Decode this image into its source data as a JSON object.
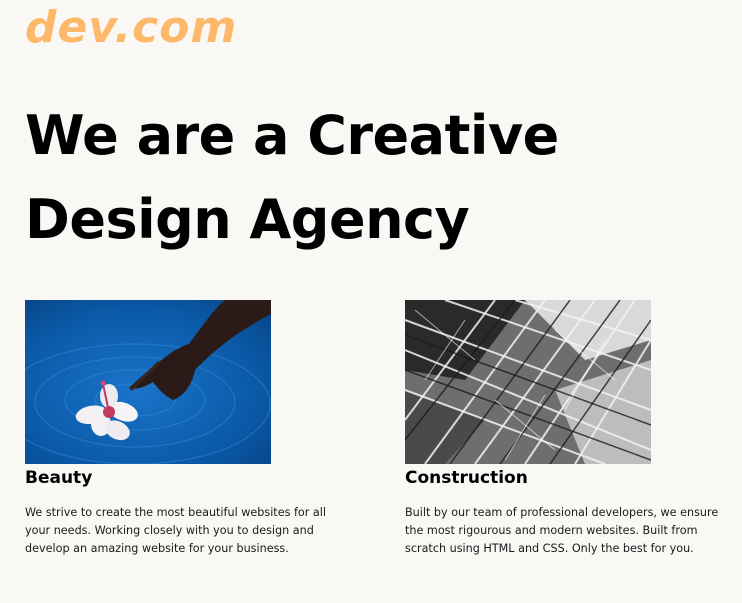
{
  "brand": {
    "logo_text": "dev.com",
    "color": "#fdb86a"
  },
  "hero": {
    "line1": "We are a Creative",
    "line2": "Design Agency"
  },
  "cards": [
    {
      "title": "Beauty",
      "image": "hand-touching-water-with-hibiscus-flower",
      "text": "We strive to create the most beautiful websites for all your needs. Working closely with you to design and develop an amazing website for your business."
    },
    {
      "title": "Construction",
      "image": "steel-lattice-structure-black-and-white",
      "text": "Built by our team of professional developers, we ensure the most rigourous and modern websites. Built from scratch using HTML and CSS. Only the best for you."
    }
  ]
}
